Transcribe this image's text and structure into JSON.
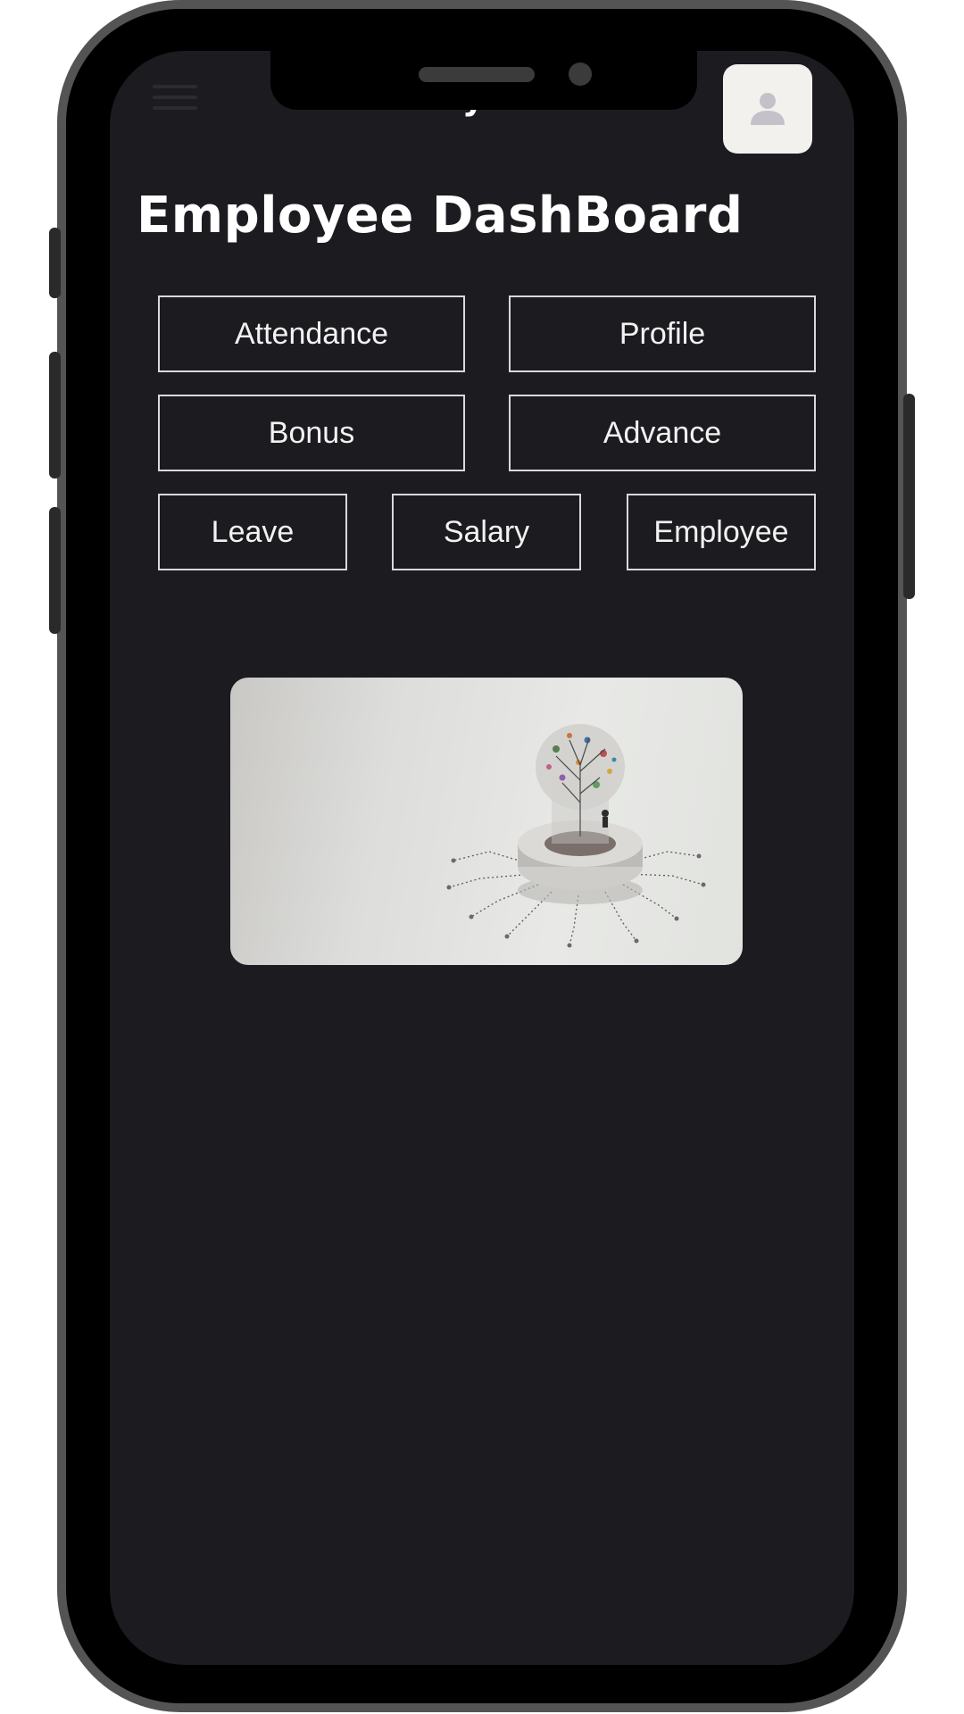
{
  "header": {
    "menu_icon": "hamburger-menu-icon",
    "app_title": "Payroll",
    "avatar_icon": "user-avatar-icon"
  },
  "page": {
    "title": "Employee DashBoard"
  },
  "buttons": {
    "attendance": "Attendance",
    "profile": "Profile",
    "bonus": "Bonus",
    "advance": "Advance",
    "leave": "Leave",
    "salary": "Salary",
    "employee": "Employee"
  },
  "hero_image": {
    "icon": "tree-brain-circuit-illustration"
  },
  "colors": {
    "screen_background": "#1c1b20",
    "button_border": "#d9d9d9",
    "text": "#ffffff",
    "avatar_background": "#f3f1ee",
    "phone_frame": "#545454"
  }
}
